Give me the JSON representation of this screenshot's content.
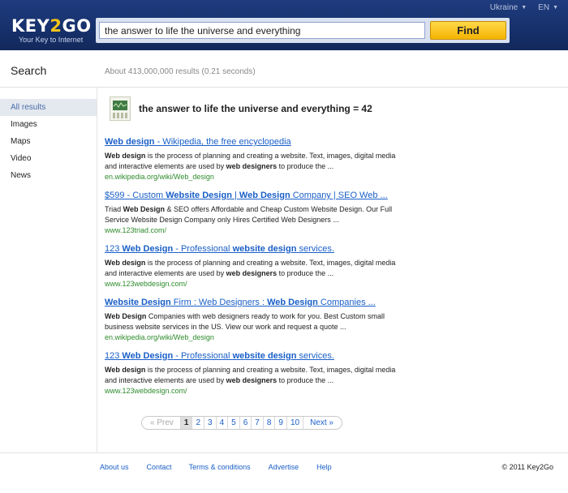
{
  "header": {
    "logo_text_a": "KEY",
    "logo_text_b": "2",
    "logo_text_c": "GO",
    "tagline": "Your Key to Internet",
    "region": "Ukraine",
    "language": "EN",
    "search_value": "the answer to life the universe and everything",
    "find_label": "Find"
  },
  "page_title": "Search",
  "stats": "About 413,000,000 results (0.21 seconds)",
  "sidebar": {
    "items": [
      {
        "label": "All results",
        "active": true
      },
      {
        "label": "Images"
      },
      {
        "label": "Maps"
      },
      {
        "label": "Video"
      },
      {
        "label": "News"
      }
    ]
  },
  "answer": {
    "text": "the answer to life the universe and everything = 42",
    "icon": "calculator-icon"
  },
  "results": [
    {
      "title_parts": [
        [
          "Web design",
          true
        ],
        [
          " - Wikipedia, the free encyclopedia",
          false
        ]
      ],
      "snippet_parts": [
        [
          "Web design",
          true
        ],
        [
          " is the process of planning and creating a website. Text, images, digital media and interactive elements are used by ",
          false
        ],
        [
          "web designers",
          true
        ],
        [
          " to produce the ...",
          false
        ]
      ],
      "url": "en.wikipedia.org/wiki/Web_design"
    },
    {
      "title_parts": [
        [
          "$599 - Custom ",
          false
        ],
        [
          "Website Design",
          true
        ],
        [
          " | ",
          false
        ],
        [
          "Web Design",
          true
        ],
        [
          " Company | SEO Web ...",
          false
        ]
      ],
      "snippet_parts": [
        [
          "Triad ",
          false
        ],
        [
          "Web Design",
          true
        ],
        [
          " & SEO offers Affordable and Cheap Custom Website Design. Our Full Service Website Design Company only Hires Certified Web Designers ...",
          false
        ]
      ],
      "url": "www.123triad.com/"
    },
    {
      "title_parts": [
        [
          "123 ",
          false
        ],
        [
          "Web Design",
          true
        ],
        [
          " - Professional ",
          false
        ],
        [
          "website design",
          true
        ],
        [
          " services.",
          false
        ]
      ],
      "snippet_parts": [
        [
          "Web design",
          true
        ],
        [
          " is the process of planning and creating a website. Text, images, digital media and interactive elements are used by ",
          false
        ],
        [
          "web designers",
          true
        ],
        [
          " to produce the ...",
          false
        ]
      ],
      "url": "www.123webdesign.com/"
    },
    {
      "title_parts": [
        [
          "Website Design",
          true
        ],
        [
          " Firm : Web Designers : ",
          false
        ],
        [
          "Web Design",
          true
        ],
        [
          " Companies ...",
          false
        ]
      ],
      "snippet_parts": [
        [
          "Web Design",
          true
        ],
        [
          " Companies with web designers ready to work for you. Best Custom small business website services in the US. View our work and request a quote ...",
          false
        ]
      ],
      "url": "en.wikipedia.org/wiki/Web_design"
    },
    {
      "title_parts": [
        [
          "123 ",
          false
        ],
        [
          "Web Design",
          true
        ],
        [
          " - Professional ",
          false
        ],
        [
          "website design",
          true
        ],
        [
          " services.",
          false
        ]
      ],
      "snippet_parts": [
        [
          "Web design",
          true
        ],
        [
          " is the process of planning and creating a website. Text, images, digital media and interactive elements are used by ",
          false
        ],
        [
          "web designers",
          true
        ],
        [
          " to produce the ...",
          false
        ]
      ],
      "url": "www.123webdesign.com/"
    }
  ],
  "pagination": {
    "prev": "« Prev",
    "pages": [
      "1",
      "2",
      "3",
      "4",
      "5",
      "6",
      "7",
      "8",
      "9",
      "10"
    ],
    "current": "1",
    "next": "Next »"
  },
  "footer": {
    "links": [
      "About us",
      "Contact",
      "Terms & conditions",
      "Advertise",
      "Help"
    ],
    "copyright": "© 2011 Key2Go"
  },
  "colors": {
    "header_bg": "#1a3573",
    "link": "#1a5fc7",
    "url_green": "#2e8b2e",
    "find_yellow": "#f5b400",
    "logo_accent": "#f2c21b"
  }
}
